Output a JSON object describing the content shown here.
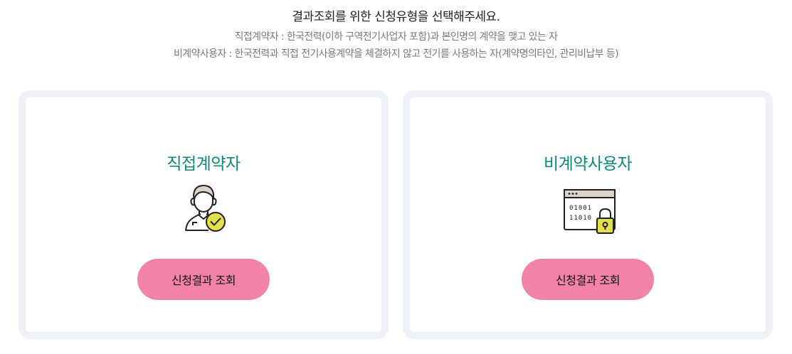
{
  "intro": {
    "title": "결과조회를 위한 신청유형을 선택해주세요.",
    "line1": "직접계약자 : 한국전력(이하 구역전기사업자 포함)과 본인명의 계약을 맺고 있는 자",
    "line2": "비계약사용자 : 한국전력과 직접 전기사용계약을 체결하지 않고 전기를 사용하는 자(계약명의타인, 관리비납부 등)"
  },
  "cards": [
    {
      "title": "직접계약자",
      "icon": "user-check-icon",
      "button_label": "신청결과 조회"
    },
    {
      "title": "비계약사용자",
      "icon": "browser-lock-icon",
      "button_label": "신청결과 조회",
      "icon_text_1": "01001",
      "icon_text_2": "11010"
    }
  ],
  "colors": {
    "title_accent": "#12867a",
    "button_bg": "#f083a6",
    "card_border": "#eef1f6",
    "icon_accent": "#e3df4f"
  }
}
